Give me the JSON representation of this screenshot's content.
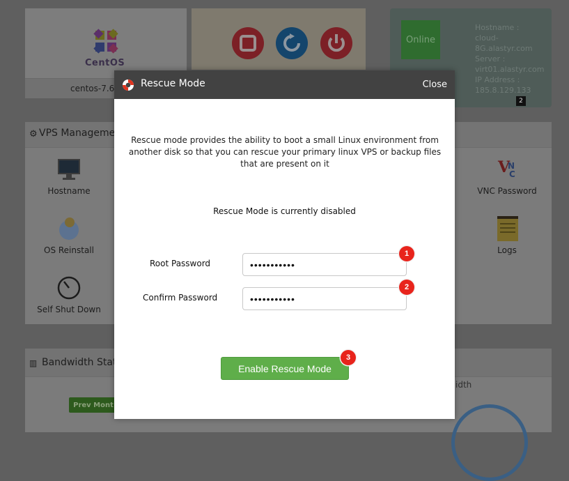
{
  "background": {
    "os_card": {
      "logo_text": "CentOS",
      "os_name": "centos-7.6-"
    },
    "status_card": {
      "online_label": "Online",
      "info_lines": [
        "Hostname :",
        "cloud-",
        "8G.alastyr.com",
        "Server :",
        "virt01.alastyr.com",
        "IP Address :",
        "185.8.129.133"
      ],
      "ip_count": "2"
    },
    "vps_management": {
      "title": "VPS Manageme",
      "tiles": [
        {
          "label": "Hostname",
          "icon": "monitor-icon"
        },
        {
          "label": "VNC Password",
          "icon": "vnc-icon"
        },
        {
          "label": "OS Reinstall",
          "icon": "os-reinstall-icon"
        },
        {
          "label": "Logs",
          "icon": "logs-icon"
        },
        {
          "label": "Self Shut Down",
          "icon": "self-shutdown-icon"
        }
      ]
    },
    "bandwidth": {
      "title": "Bandwidth Stat",
      "prev_month": "Prev Mont",
      "side_label": "idth"
    }
  },
  "modal": {
    "title": "Rescue Mode",
    "close_label": "Close",
    "description": "Rescue mode provides the ability to boot a small Linux environment from another disk so that you can rescue your primary linux VPS or backup files that are present on it",
    "status_text": "Rescue Mode is currently disabled",
    "root_password_label": "Root Password",
    "root_password_value": "•••••••••••",
    "confirm_password_label": "Confirm Password",
    "confirm_password_value": "•••••••••••",
    "enable_button_label": "Enable Rescue Mode",
    "markers": [
      "1",
      "2",
      "3"
    ]
  },
  "colors": {
    "modal_header": "#424242",
    "enable_button": "#5fae4a",
    "marker": "#e8241c",
    "overlay": "#5f5f5f"
  }
}
